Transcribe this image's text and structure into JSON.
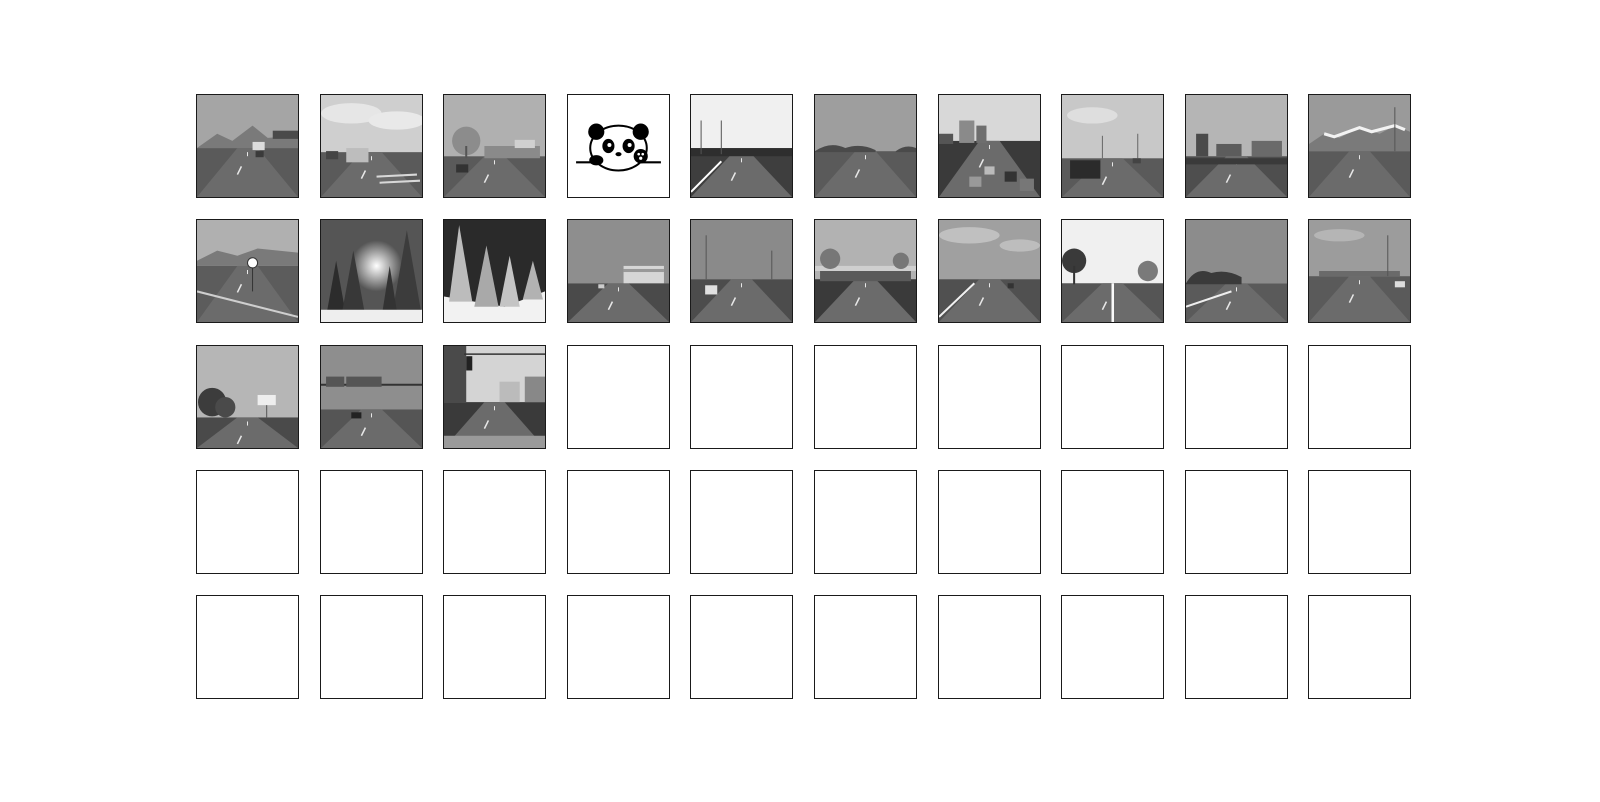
{
  "grid": {
    "rows": 5,
    "columns": 10,
    "color_mode": "grayscale",
    "cells": [
      {
        "content": "photo",
        "scene": "road-mountains-overpass"
      },
      {
        "content": "photo",
        "scene": "road-cloudy-trucks-crosswalk"
      },
      {
        "content": "photo",
        "scene": "road-bare-tree-building"
      },
      {
        "content": "illustration",
        "scene": "panda-peeking"
      },
      {
        "content": "photo",
        "scene": "road-bright-sky-poles"
      },
      {
        "content": "photo",
        "scene": "highway-trees"
      },
      {
        "content": "photo",
        "scene": "city-highway-traffic"
      },
      {
        "content": "photo",
        "scene": "road-car-street-lamps"
      },
      {
        "content": "photo",
        "scene": "road-buildings-cloudy"
      },
      {
        "content": "photo",
        "scene": "road-snowy-mountains"
      },
      {
        "content": "photo",
        "scene": "roundabout-road-sign"
      },
      {
        "content": "photo",
        "scene": "snowy-forest-sun"
      },
      {
        "content": "photo",
        "scene": "snowy-forest-slope"
      },
      {
        "content": "photo",
        "scene": "highway-factory-building"
      },
      {
        "content": "photo",
        "scene": "highway-car-lamps"
      },
      {
        "content": "photo",
        "scene": "toll-station"
      },
      {
        "content": "photo",
        "scene": "highway-cloudy-cars"
      },
      {
        "content": "photo",
        "scene": "road-center-line-trees"
      },
      {
        "content": "photo",
        "scene": "highway-treeline"
      },
      {
        "content": "photo",
        "scene": "highway-distant-city"
      },
      {
        "content": "photo",
        "scene": "highway-trees-billboard"
      },
      {
        "content": "photo",
        "scene": "highway-overhead-signs"
      },
      {
        "content": "photo",
        "scene": "city-street-traffic-light"
      },
      {
        "content": "empty"
      },
      {
        "content": "empty"
      },
      {
        "content": "empty"
      },
      {
        "content": "empty"
      },
      {
        "content": "empty"
      },
      {
        "content": "empty"
      },
      {
        "content": "empty"
      },
      {
        "content": "empty"
      },
      {
        "content": "empty"
      },
      {
        "content": "empty"
      },
      {
        "content": "empty"
      },
      {
        "content": "empty"
      },
      {
        "content": "empty"
      },
      {
        "content": "empty"
      },
      {
        "content": "empty"
      },
      {
        "content": "empty"
      },
      {
        "content": "empty"
      },
      {
        "content": "empty"
      },
      {
        "content": "empty"
      },
      {
        "content": "empty"
      },
      {
        "content": "empty"
      },
      {
        "content": "empty"
      },
      {
        "content": "empty"
      },
      {
        "content": "empty"
      },
      {
        "content": "empty"
      },
      {
        "content": "empty"
      },
      {
        "content": "empty"
      }
    ]
  }
}
